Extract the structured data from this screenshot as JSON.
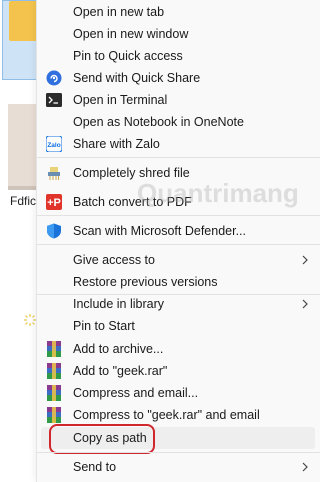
{
  "background": {
    "file_label": "Fdfic"
  },
  "watermark": "Quantrimang",
  "menu": {
    "items": [
      {
        "label": "Open in new tab",
        "icon": "",
        "submenu": false
      },
      {
        "label": "Open in new window",
        "icon": "",
        "submenu": false
      },
      {
        "label": "Pin to Quick access",
        "icon": "",
        "submenu": false
      },
      {
        "label": "Send with Quick Share",
        "icon": "quick-share-icon",
        "submenu": false
      },
      {
        "label": "Open in Terminal",
        "icon": "terminal-icon",
        "submenu": false
      },
      {
        "label": "Open as Notebook in OneNote",
        "icon": "",
        "submenu": false
      },
      {
        "label": "Share with Zalo",
        "icon": "zalo-icon",
        "submenu": false
      },
      {
        "label": "Completely shred file",
        "icon": "shred-icon",
        "submenu": false
      },
      {
        "label": "Batch convert to PDF",
        "icon": "pdf-icon",
        "submenu": false
      },
      {
        "label": "Scan with Microsoft Defender...",
        "icon": "defender-shield-icon",
        "submenu": false
      },
      {
        "label": "Give access to",
        "icon": "",
        "submenu": true
      },
      {
        "label": "Restore previous versions",
        "icon": "",
        "submenu": false
      },
      {
        "label": "Include in library",
        "icon": "",
        "submenu": true
      },
      {
        "label": "Pin to Start",
        "icon": "",
        "submenu": false
      },
      {
        "label": "Add to archive...",
        "icon": "winrar-icon",
        "submenu": false
      },
      {
        "label": "Add to \"geek.rar\"",
        "icon": "winrar-icon",
        "submenu": false
      },
      {
        "label": "Compress and email...",
        "icon": "winrar-icon",
        "submenu": false
      },
      {
        "label": "Compress to \"geek.rar\" and email",
        "icon": "winrar-icon",
        "submenu": false
      },
      {
        "label": "Copy as path",
        "icon": "",
        "submenu": false,
        "highlighted": true
      },
      {
        "label": "Send to",
        "icon": "",
        "submenu": true
      }
    ]
  },
  "colors": {
    "highlight_border": "#d0272d",
    "menu_bg": "#f9f9f9"
  }
}
